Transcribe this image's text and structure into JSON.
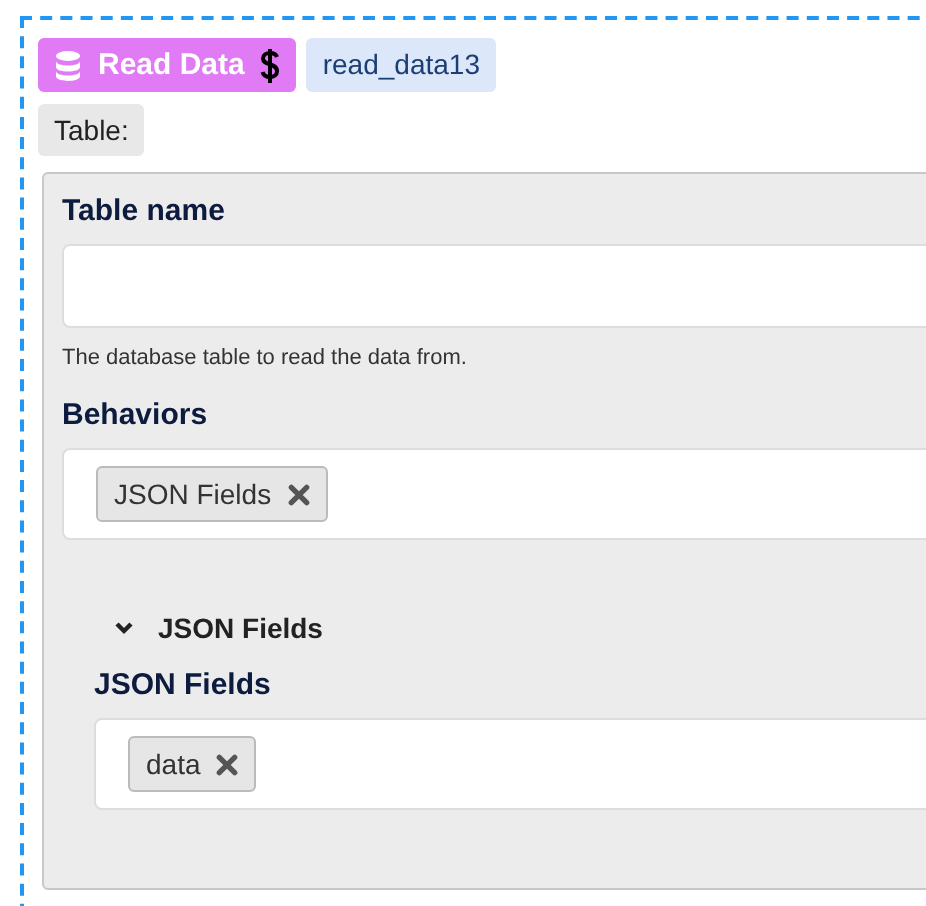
{
  "block": {
    "type": "Read Data",
    "name": "read_data13"
  },
  "section_label": "Table:",
  "fields": [
    {
      "kind": "text",
      "label": "Table name",
      "help": "The database table to read the data from."
    },
    {
      "kind": "tags",
      "label": "Behaviors",
      "tags": [
        "JSON Fields"
      ]
    }
  ],
  "groups": [
    {
      "title": "JSON Fields",
      "expanded": true,
      "fields": [
        {
          "kind": "tags",
          "label": "JSON Fields",
          "tags": [
            "data"
          ]
        }
      ]
    }
  ]
}
